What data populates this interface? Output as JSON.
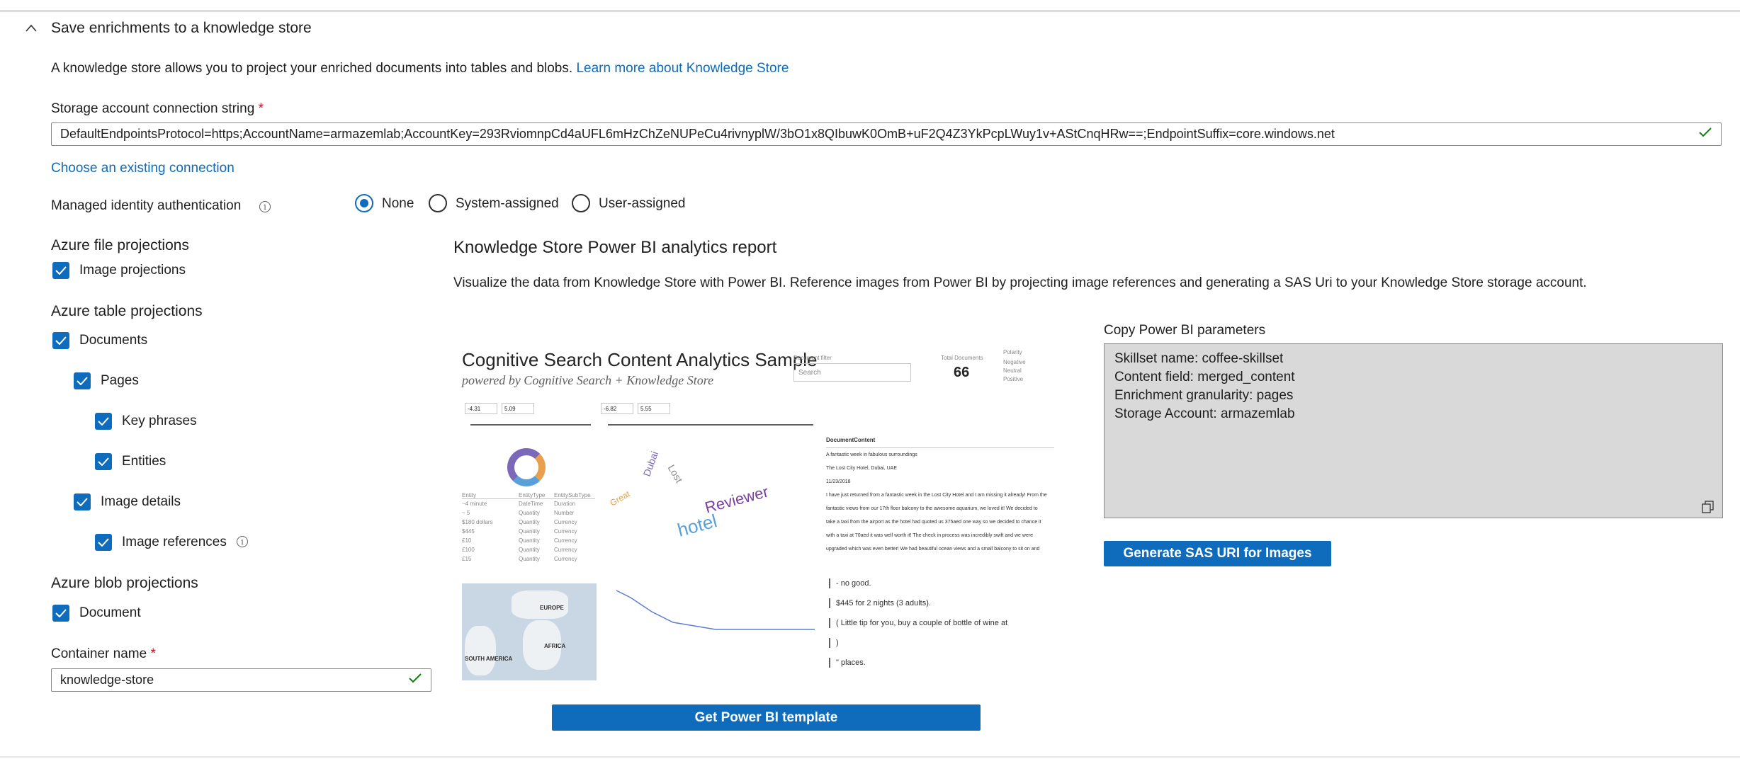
{
  "section": {
    "title": "Save enrichments to a knowledge store",
    "description": "A knowledge store allows you to project your enriched documents into tables and blobs.",
    "learn_more": "Learn more about Knowledge Store"
  },
  "storage": {
    "label": "Storage account connection string",
    "required_mark": "*",
    "value": "DefaultEndpointsProtocol=https;AccountName=armazemlab;AccountKey=293RviomnpCd4aUFL6mHzChZeNUPeCu4rivnyplW/3bO1x8QIbuwK0OmB+uF2Q4Z3YkPcpLWuy1v+AStCnqHRw==;EndpointSuffix=core.windows.net",
    "choose_link": "Choose an existing connection"
  },
  "identity": {
    "label": "Managed identity authentication",
    "options": [
      "None",
      "System-assigned",
      "User-assigned"
    ],
    "selected": "None"
  },
  "file_projections": {
    "title": "Azure file projections",
    "image_projections": "Image projections"
  },
  "table_projections": {
    "title": "Azure table projections",
    "documents": "Documents",
    "pages": "Pages",
    "key_phrases": "Key phrases",
    "entities": "Entities",
    "image_details": "Image details",
    "image_references": "Image references"
  },
  "blob_projections": {
    "title": "Azure blob projections",
    "document": "Document"
  },
  "container": {
    "label": "Container name",
    "required_mark": "*",
    "value": "knowledge-store"
  },
  "report": {
    "title": "Knowledge Store Power BI analytics report",
    "description": "Visualize the data from Knowledge Store with Power BI. Reference images from Power BI by projecting image references and generating a SAS Uri to your Knowledge Store storage account.",
    "template_button": "Get Power BI template"
  },
  "preview": {
    "title": "Cognitive Search Content Analytics Sample",
    "subtitle": "powered by Cognitive Search + Knowledge Store",
    "search_placeholder": "Search",
    "total_documents": "66",
    "total_documents_label": "Total Documents",
    "polarity_label": "Polarity",
    "polarity": [
      "Negative",
      "Neutral",
      "Positive"
    ],
    "entity_range": [
      "-4.31",
      "5.09"
    ],
    "keyphrase_range": [
      "-6.82",
      "5.55"
    ],
    "doc_lines": [
      "A fantastic week in fabulous surroundings",
      "The Lost City Hotel, Dubai, UAE",
      "11/23/2018",
      "I have just returned from a fantastic week in the Lost City Hotel and I am missing it already! From the",
      "fantastic views from our 17th floor balcony to the awesome aquarium, we loved it! We decided to",
      "take a taxi from the airport as the hotel had quoted us 375aed one way so we decided to chance it",
      "with a taxi at 70aed it was well worth it! The check in process was incredibly swift and we were",
      "upgraded which was even better! We had beautiful ocean views and a small balcony to sit on and"
    ],
    "segments": [
      "- no good.",
      "$445 for 2 nights (3 adults).",
      "( Little tip for you, buy a couple of bottle of wine at",
      ")",
      "\" places."
    ],
    "table_rows": [
      [
        "~4 minute",
        "DateTime",
        "Duration"
      ],
      [
        "~ 5",
        "Quantity",
        "Number"
      ],
      [
        "$180 dollars",
        "Quantity",
        "Currency"
      ],
      [
        "$445",
        "Quantity",
        "Currency"
      ],
      [
        "£10",
        "Quantity",
        "Currency"
      ],
      [
        "£100",
        "Quantity",
        "Currency"
      ],
      [
        "£15",
        "Quantity",
        "Currency"
      ]
    ],
    "map_labels": [
      "EUROPE",
      "AFRICA",
      "SOUTH AMERICA"
    ],
    "words": [
      "Reviewer",
      "hotel",
      "Dubai",
      "Lost",
      "Great"
    ]
  },
  "parameters": {
    "label": "Copy Power BI parameters",
    "lines": [
      "Skillset name: coffee-skillset",
      "Content field: merged_content",
      "Enrichment granularity: pages",
      "Storage Account: armazemlab"
    ],
    "sas_button": "Generate SAS URI for Images"
  },
  "colors": {
    "accent": "#0f6cbd",
    "success": "#107c10",
    "required": "#c50f1f"
  }
}
